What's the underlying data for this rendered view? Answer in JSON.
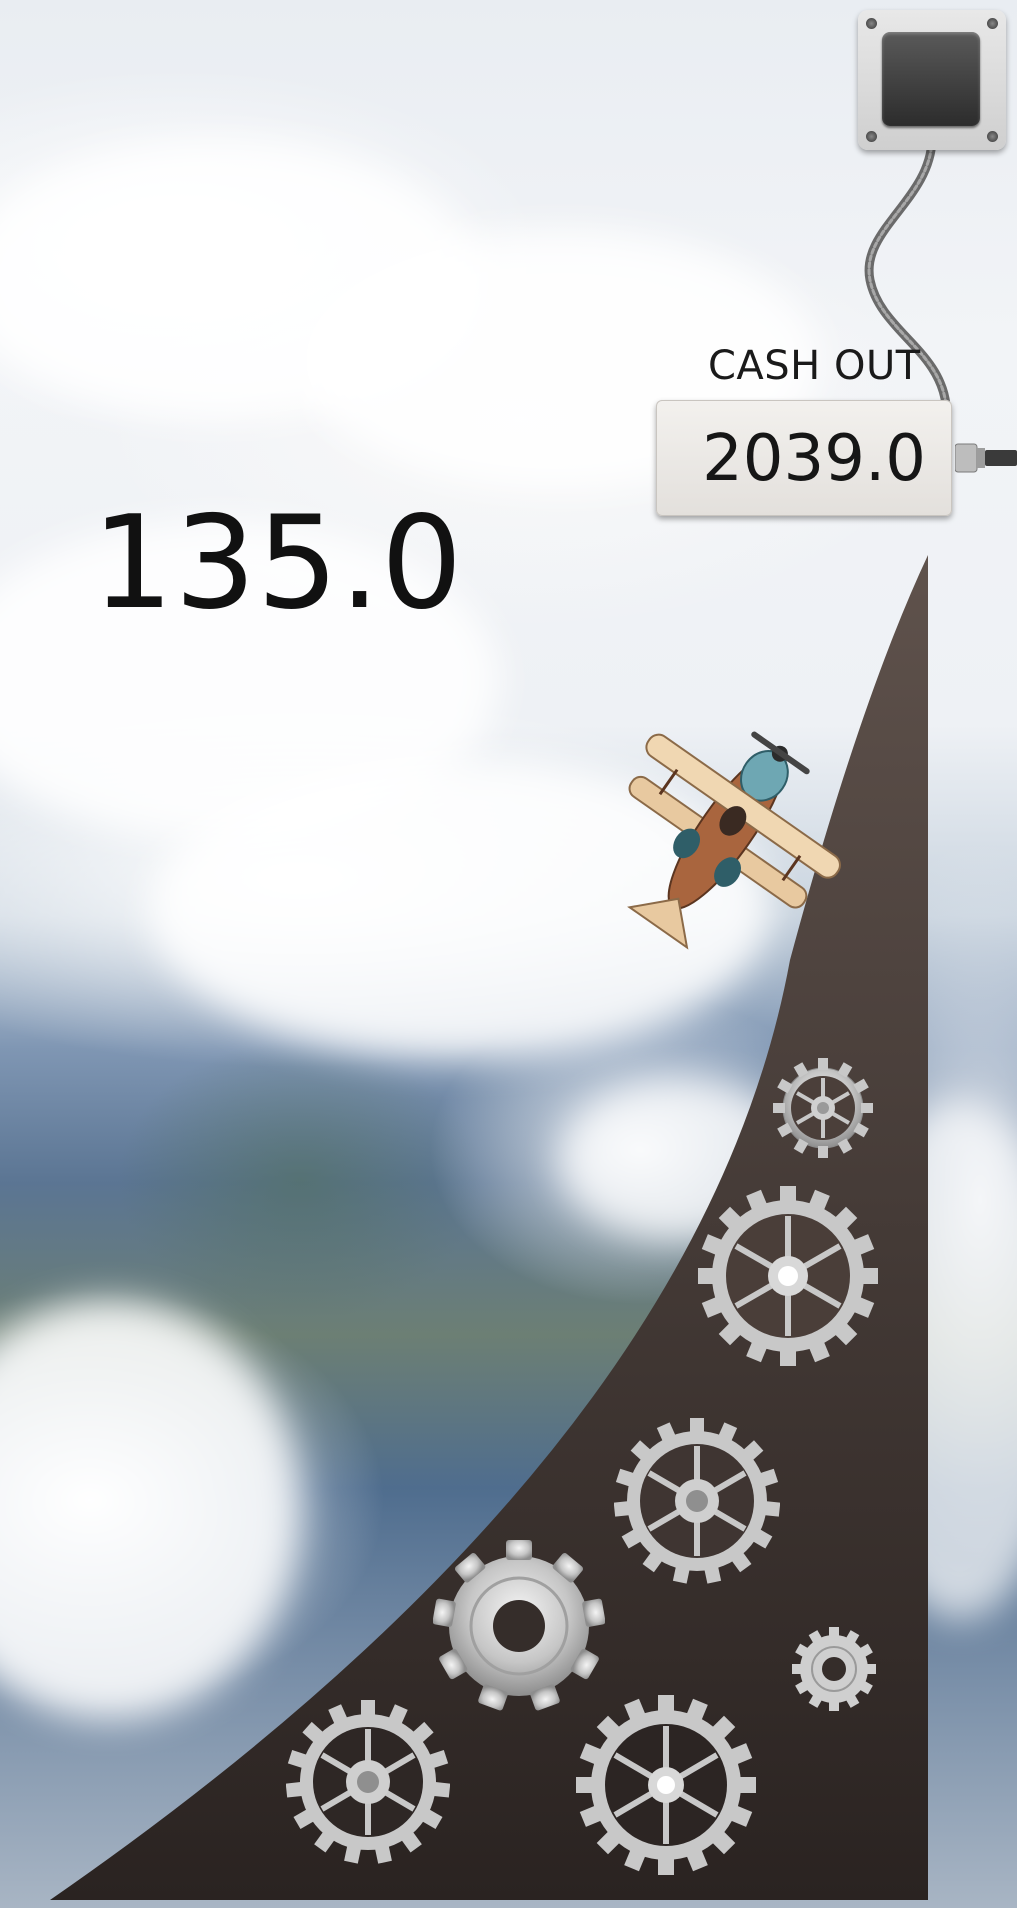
{
  "game": {
    "multiplier_value": "135.0",
    "cash_out": {
      "label": "CASH OUT",
      "value": "2039.0"
    }
  },
  "icons": {
    "cash_out_button": "push-button-icon",
    "plane": "biplane-icon",
    "gears": "gear-icon"
  },
  "colors": {
    "ramp_top": "#5b4d47",
    "ramp_bottom": "#2b2422",
    "gear": "#c8c8c8",
    "text": "#111111"
  }
}
